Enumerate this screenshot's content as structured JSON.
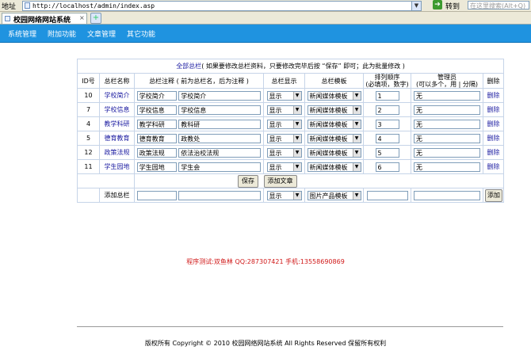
{
  "browser": {
    "address_label": "地址",
    "url": "http://localhost/admin/index.asp",
    "go_label": "转到",
    "search_placeholder": "在这里搜索(Alt+Q)",
    "tab_title": "校园网络网站系统",
    "tab_close": "×",
    "new_tab": "+"
  },
  "nav": {
    "items": [
      "系统管理",
      "附加功能",
      "文章管理",
      "其它功能"
    ]
  },
  "panel": {
    "title_link": "全部总栏",
    "title_note": "( 如果要修改总栏资料，只要修改完毕后按 “保存” 即可；此为批量修改 )",
    "columns": {
      "id": "ID号",
      "name": "总栏名称",
      "note": "总栏注释 ( 前为总栏名，后为注释 )",
      "display": "总栏显示",
      "template": "总栏模板",
      "order_line1": "排列顺序",
      "order_line2": "(必填项，数字)",
      "admin_line1": "管理员",
      "admin_line2": "(可以多个，用 | 分隔)",
      "delete": "删除"
    },
    "rows": [
      {
        "id": "10",
        "name": "学校简介",
        "note_name": "学校简介",
        "note_text": "学校简介",
        "display": "显示",
        "template": "新闻媒体模板",
        "order": "1",
        "admin": "无",
        "delete": "删除"
      },
      {
        "id": "7",
        "name": "学校信息",
        "note_name": "学校信息",
        "note_text": "学校信息",
        "display": "显示",
        "template": "新闻媒体模板",
        "order": "2",
        "admin": "无",
        "delete": "删除"
      },
      {
        "id": "4",
        "name": "教学科研",
        "note_name": "教学科研",
        "note_text": "教科研",
        "display": "显示",
        "template": "新闻媒体模板",
        "order": "3",
        "admin": "无",
        "delete": "删除"
      },
      {
        "id": "5",
        "name": "德育教育",
        "note_name": "德育教育",
        "note_text": "政教处",
        "display": "显示",
        "template": "新闻媒体模板",
        "order": "4",
        "admin": "无",
        "delete": "删除"
      },
      {
        "id": "12",
        "name": "政策法规",
        "note_name": "政策法规",
        "note_text": "依法治校法规",
        "display": "显示",
        "template": "新闻媒体模板",
        "order": "5",
        "admin": "无",
        "delete": "删除"
      },
      {
        "id": "11",
        "name": "学生园地",
        "note_name": "学生园地",
        "note_text": "学生会",
        "display": "显示",
        "template": "新闻媒体模板",
        "order": "6",
        "admin": "无",
        "delete": "删除"
      }
    ],
    "save_label": "保存",
    "add_article_label": "添加文章",
    "add_row": {
      "label": "添加总栏",
      "display": "显示",
      "template": "图片产品模板",
      "add_label": "添加"
    }
  },
  "contact": "程序测试:双鱼林 QQ:287307421 手机:13558690869",
  "footer": "版权所有 Copyright © 2010 校园网络网站系统 All Rights Reserved 保留所有权利"
}
